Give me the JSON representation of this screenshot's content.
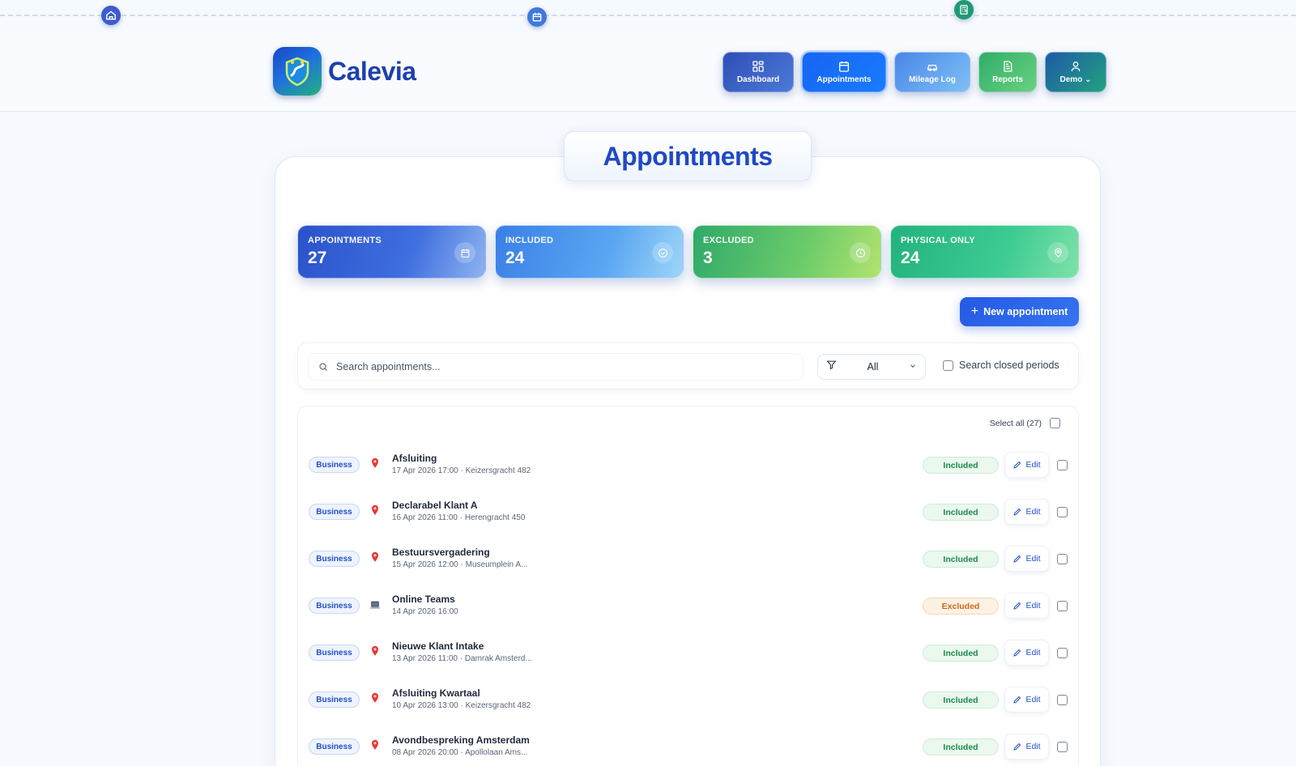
{
  "brand": {
    "name": "Calevia"
  },
  "nav": [
    {
      "label": "Dashboard",
      "icon": "dashboard-icon"
    },
    {
      "label": "Appointments",
      "icon": "calendar-icon",
      "active": true
    },
    {
      "label": "Mileage Log",
      "icon": "car-icon"
    },
    {
      "label": "Reports",
      "icon": "document-icon"
    },
    {
      "label": "Demo",
      "icon": "user-icon"
    }
  ],
  "page": {
    "title": "Appointments"
  },
  "stats": [
    {
      "label": "APPOINTMENTS",
      "value": "27",
      "icon": "calendar-icon"
    },
    {
      "label": "INCLUDED",
      "value": "24",
      "icon": "check-circle-icon"
    },
    {
      "label": "EXCLUDED",
      "value": "3",
      "icon": "clock-icon"
    },
    {
      "label": "PHYSICAL ONLY",
      "value": "24",
      "icon": "map-pin-icon"
    }
  ],
  "actions": {
    "new_label": "New appointment"
  },
  "filters": {
    "search_placeholder": "Search appointments...",
    "select_value": "All",
    "closed_periods_label": "Search closed periods"
  },
  "list": {
    "select_all_label": "Select all (27)",
    "edit_label": "Edit",
    "rows": [
      {
        "tag": "Business",
        "type": "physical",
        "title": "Afsluiting",
        "subtitle": "17 Apr 2026 17:00 · Keizersgracht 482",
        "status": "Included"
      },
      {
        "tag": "Business",
        "type": "physical",
        "title": "Declarabel Klant A",
        "subtitle": "16 Apr 2026 11:00 · Herengracht 450",
        "status": "Included"
      },
      {
        "tag": "Business",
        "type": "physical",
        "title": "Bestuursvergadering",
        "subtitle": "15 Apr 2026 12:00 · Museumplein A...",
        "status": "Included"
      },
      {
        "tag": "Business",
        "type": "online",
        "title": "Online Teams",
        "subtitle": "14 Apr 2026 16:00",
        "status": "Excluded"
      },
      {
        "tag": "Business",
        "type": "physical",
        "title": "Nieuwe Klant Intake",
        "subtitle": "13 Apr 2026 11:00 · Damrak Amsterd...",
        "status": "Included"
      },
      {
        "tag": "Business",
        "type": "physical",
        "title": "Afsluiting Kwartaal",
        "subtitle": "10 Apr 2026 13:00 · Keizersgracht 482",
        "status": "Included"
      },
      {
        "tag": "Business",
        "type": "physical",
        "title": "Avondbespreking Amsterdam",
        "subtitle": "08 Apr 2026 20:00 · Apollolaan Ams...",
        "status": "Included"
      }
    ]
  },
  "colors": {
    "brand_blue": "#1d3fae",
    "accent": "#2559e4",
    "included": "#1d8a4c",
    "excluded": "#d0681b"
  }
}
